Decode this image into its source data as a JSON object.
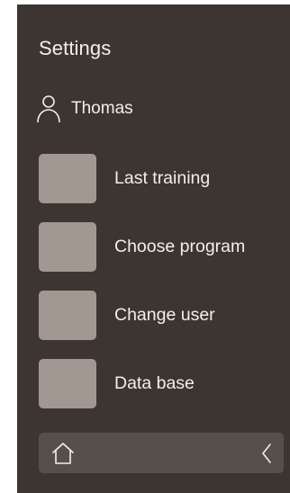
{
  "header": {
    "title": "Settings"
  },
  "user": {
    "icon": "person-icon",
    "name": "Thomas"
  },
  "menu": {
    "items": [
      {
        "label": "Last training"
      },
      {
        "label": "Choose program"
      },
      {
        "label": "Change user"
      },
      {
        "label": "Data base"
      }
    ]
  },
  "nav": {
    "home_icon": "home-icon",
    "back_icon": "chevron-left-icon"
  },
  "colors": {
    "background": "#3d3532",
    "tile": "#a39792",
    "nav_bar": "#56504d",
    "text": "#f2efec"
  }
}
